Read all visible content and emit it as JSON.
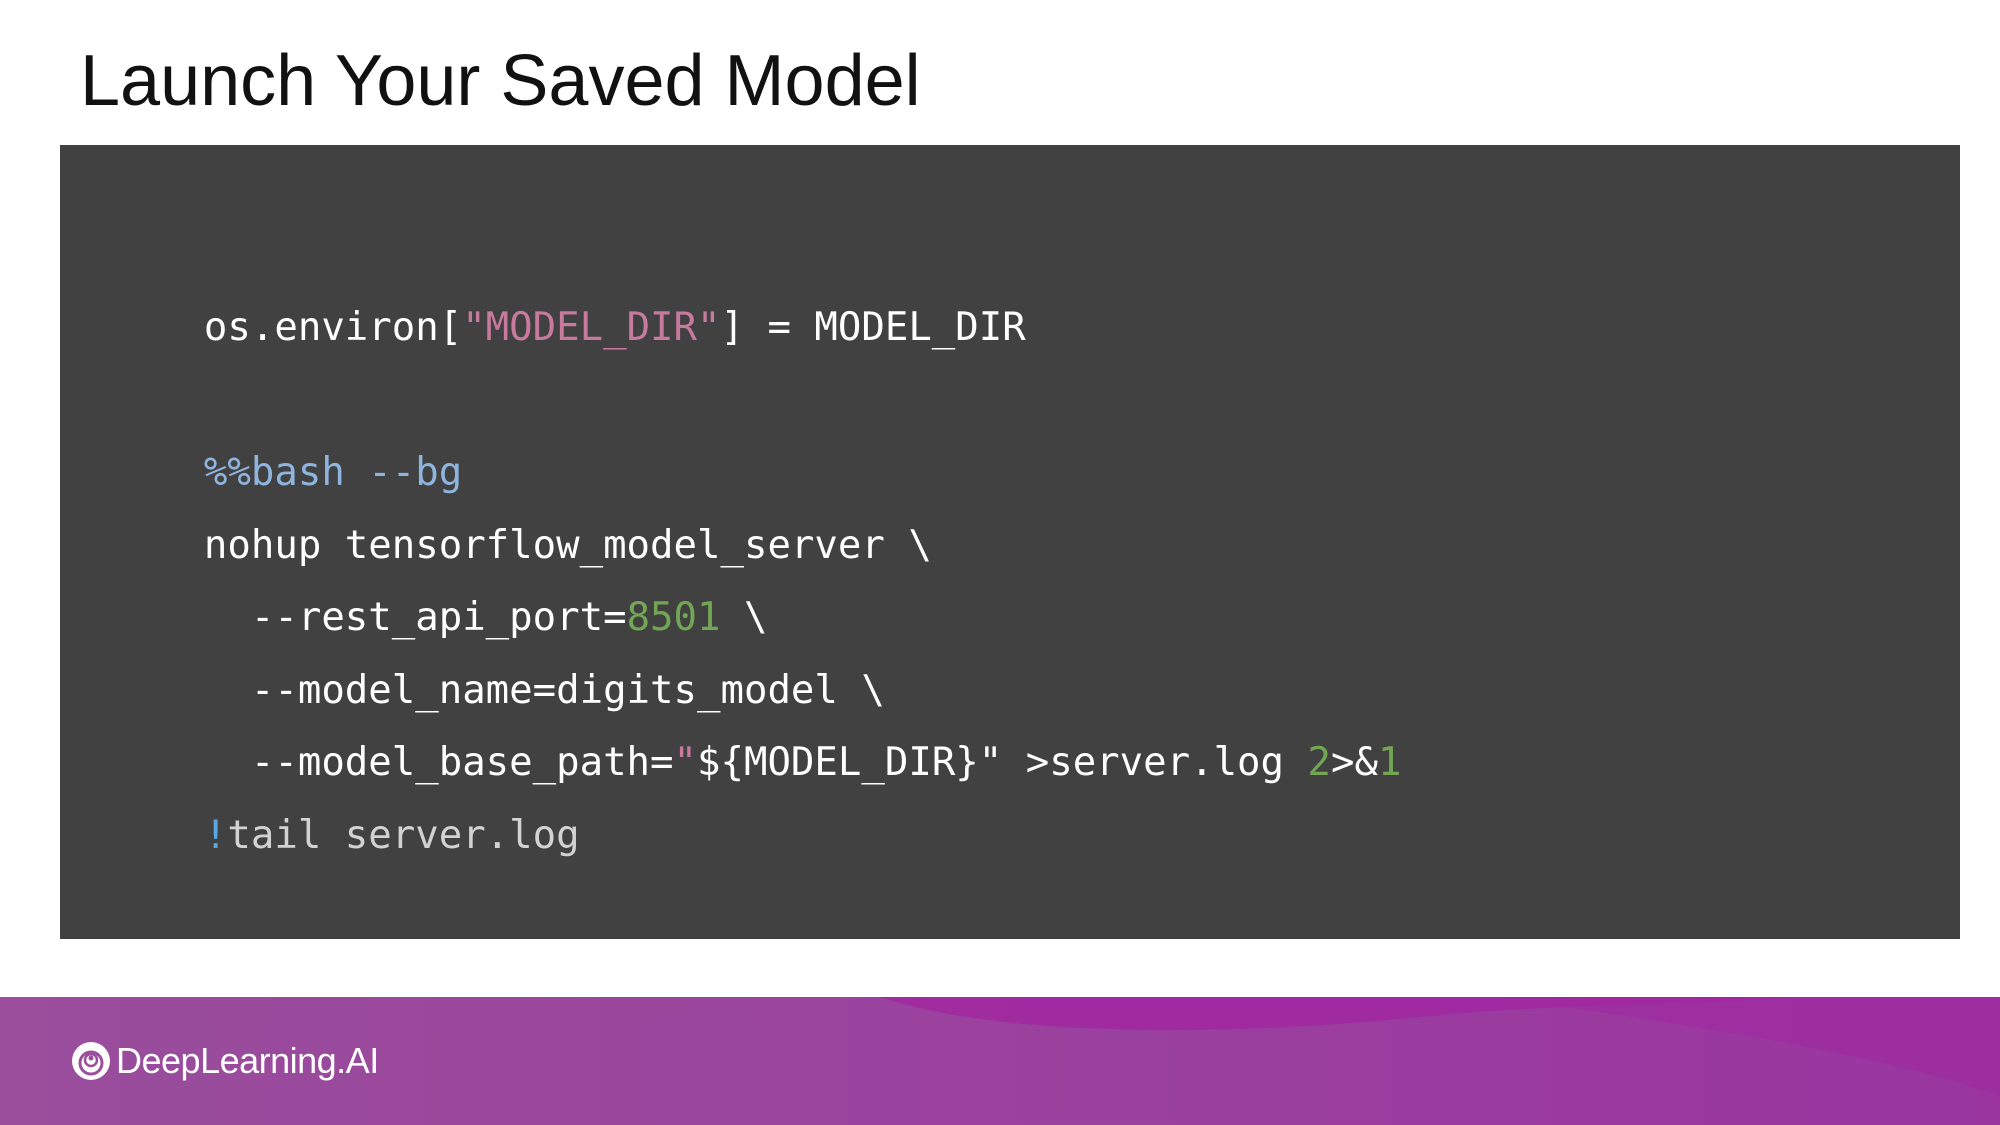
{
  "slide": {
    "title": "Launch Your Saved Model"
  },
  "code": {
    "lines": [
      {
        "tokens": [
          {
            "text": "os.environ[",
            "kind": "plain"
          },
          {
            "text": "\"MODEL_DIR\"",
            "kind": "string"
          },
          {
            "text": "] = MODEL_DIR",
            "kind": "plain"
          }
        ]
      },
      {
        "tokens": [
          {
            "text": "%%bash --bg",
            "kind": "magic"
          }
        ]
      },
      {
        "tokens": [
          {
            "text": "nohup tensorflow_model_server \\",
            "kind": "plain"
          }
        ]
      },
      {
        "tokens": [
          {
            "text": "  --rest_api_port=",
            "kind": "plain"
          },
          {
            "text": "8501",
            "kind": "number"
          },
          {
            "text": " \\",
            "kind": "plain"
          }
        ]
      },
      {
        "tokens": [
          {
            "text": "  --model_name=digits_model \\",
            "kind": "plain"
          }
        ]
      },
      {
        "tokens": [
          {
            "text": "  --model_base_path=",
            "kind": "plain"
          },
          {
            "text": "\"",
            "kind": "string"
          },
          {
            "text": "${MODEL_DIR}\" >server.log ",
            "kind": "plain"
          },
          {
            "text": "2",
            "kind": "number"
          },
          {
            "text": ">&",
            "kind": "plain"
          },
          {
            "text": "1",
            "kind": "number"
          }
        ]
      },
      {
        "tokens": [
          {
            "text": "!",
            "kind": "bang"
          },
          {
            "text": "tail server.log",
            "kind": "dim"
          }
        ]
      }
    ]
  },
  "footer": {
    "brand_name": "DeepLearning.AI",
    "logo_icon": "deeplearning-ai-logo-icon",
    "colors": {
      "gradient_start": "#9a4e9c",
      "gradient_end": "#9a35a0",
      "wave": "#a128a0"
    }
  },
  "colors": {
    "code_background": "#414141",
    "string": "#c7799e",
    "keyword_magic": "#8fb4de",
    "number": "#72a653",
    "bang": "#5aa7e4"
  }
}
